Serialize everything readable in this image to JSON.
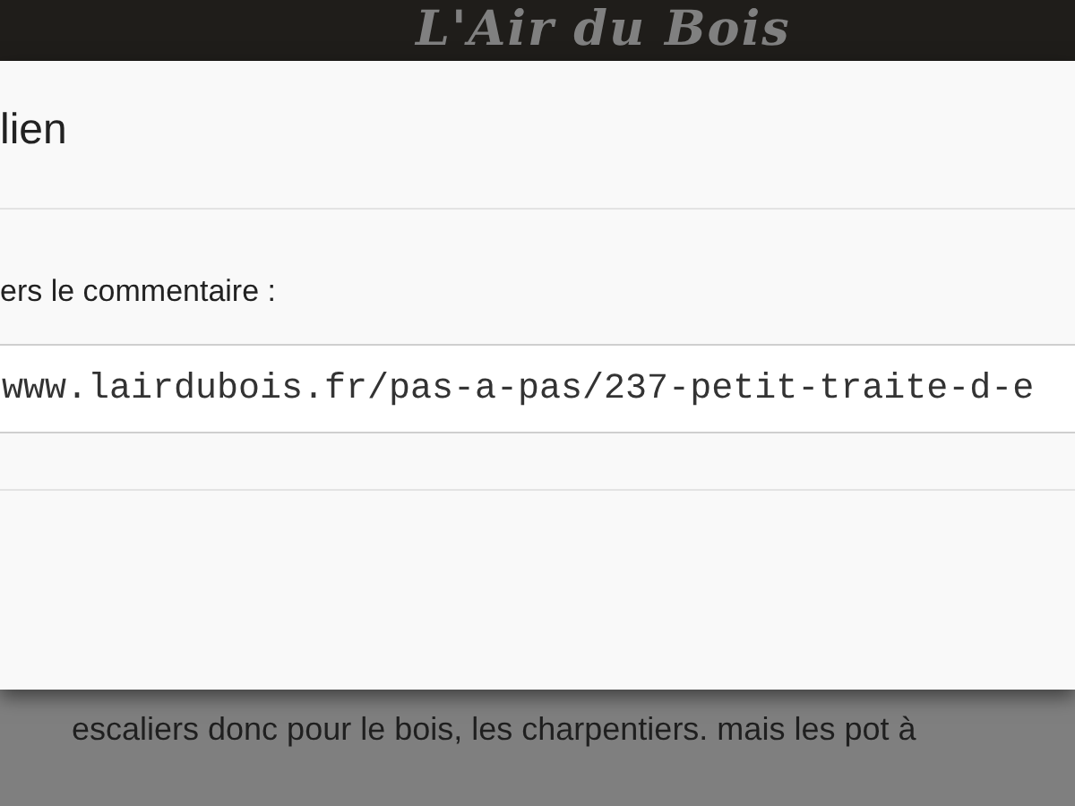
{
  "header": {
    "logo": "L'Air du Bois"
  },
  "dialog": {
    "title": "lien",
    "label": "ers le commentaire :",
    "link_field": {
      "value": "www.lairdubois.fr/pas-a-pas/237-petit-traite-d-e"
    }
  },
  "page": {
    "text": "escaliers donc pour le bois, les charpentiers. mais les pot à"
  }
}
